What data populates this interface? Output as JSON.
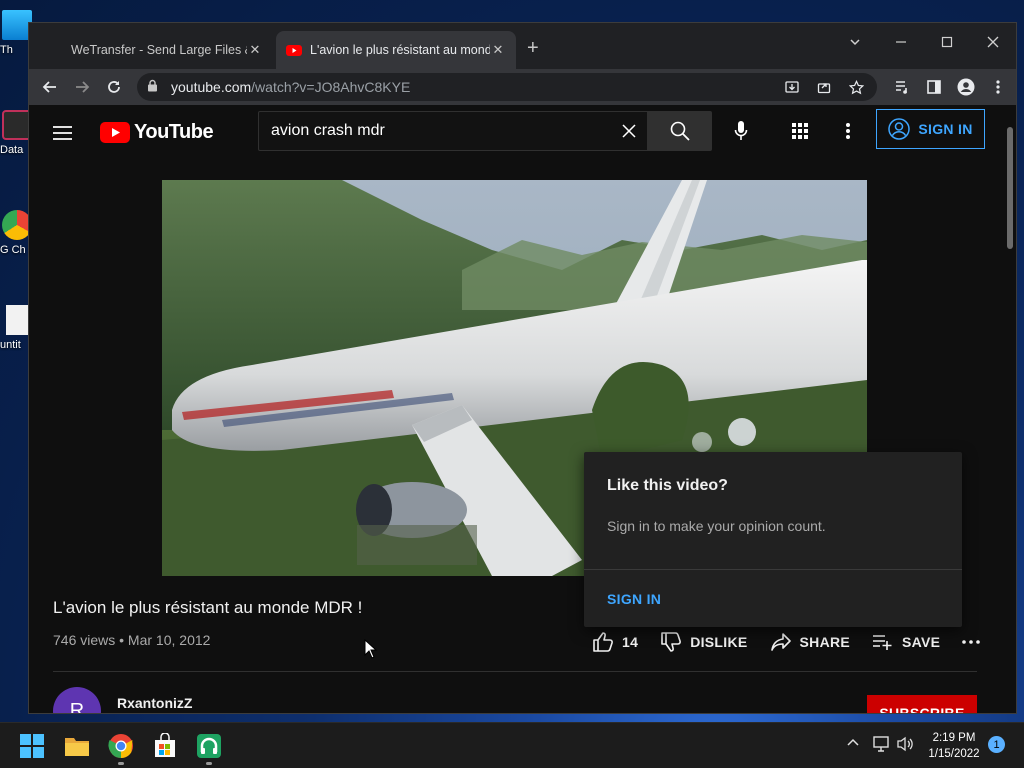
{
  "desktop": {
    "icons": [
      {
        "label": "Th"
      },
      {
        "label": "Data"
      },
      {
        "label": "G Ch"
      },
      {
        "label": "untit"
      }
    ]
  },
  "browser": {
    "tabs": [
      {
        "title": "WeTransfer - Send Large Files &",
        "active": false
      },
      {
        "title": "L'avion le plus résistant au monde",
        "active": true
      }
    ],
    "url_host": "youtube.com",
    "url_path": "/watch?v=JO8AhvC8KYE"
  },
  "youtube": {
    "logo_text": "YouTube",
    "search_value": "avion crash mdr",
    "sign_in_label": "SIGN IN",
    "video": {
      "title": "L'avion le plus résistant au monde MDR !",
      "meta": "746 views • Mar 10, 2012",
      "likes": "14",
      "dislike_label": "DISLIKE",
      "share_label": "SHARE",
      "save_label": "SAVE"
    },
    "channel": {
      "avatar_letter": "R",
      "name": "RxantonizZ",
      "subscribe_label": "SUBSCRIBE"
    },
    "like_popup": {
      "title": "Like this video?",
      "message": "Sign in to make your opinion count.",
      "sign_in_label": "SIGN IN"
    }
  },
  "taskbar": {
    "time": "2:19 PM",
    "date": "1/15/2022",
    "notification_count": "1"
  },
  "colors": {
    "yt_bg": "#0f0f0f",
    "yt_red": "#ff0000",
    "accent_blue": "#3ea6ff",
    "subscribe_red": "#cc0000"
  }
}
